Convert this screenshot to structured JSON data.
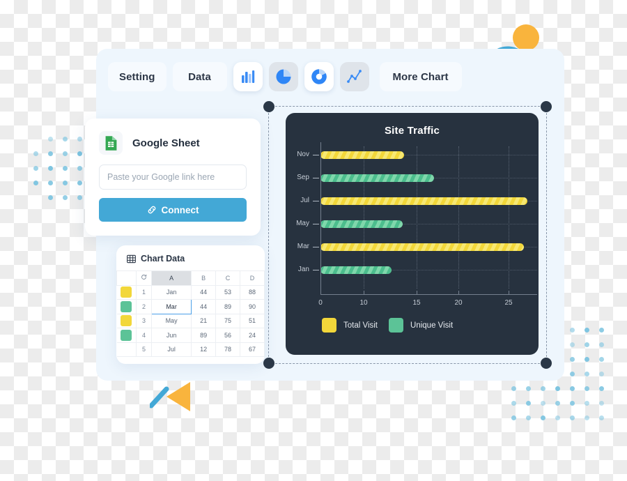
{
  "toolbar": {
    "setting_label": "Setting",
    "data_label": "Data",
    "more_chart_label": "More Chart",
    "chart_types": [
      {
        "name": "bar-chart-icon",
        "selected": true
      },
      {
        "name": "pie-chart-icon",
        "selected": false
      },
      {
        "name": "donut-chart-icon",
        "selected": true
      },
      {
        "name": "line-chart-icon",
        "selected": false
      }
    ]
  },
  "google_sheet": {
    "title": "Google Sheet",
    "icon": "google-sheets-icon",
    "input_placeholder": "Paste your Google link here",
    "input_value": "",
    "connect_label": "Connect",
    "connect_icon": "link-icon",
    "connect_color": "#43a8d6"
  },
  "chart_data_panel": {
    "title": "Chart Data",
    "icon": "table-icon",
    "refresh_icon": "refresh-icon",
    "columns": [
      "A",
      "B",
      "C",
      "D"
    ],
    "selected_column": "A",
    "selected_cell": {
      "row": 2,
      "column": "A",
      "value": "Mar"
    },
    "rows": [
      {
        "num": "1",
        "swatch": "#f2d73a",
        "A": "Jan",
        "B": "44",
        "C": "53",
        "D": "88"
      },
      {
        "num": "2",
        "swatch": "#5cc397",
        "A": "Mar",
        "B": "44",
        "C": "89",
        "D": "90"
      },
      {
        "num": "3",
        "swatch": "#f2d73a",
        "A": "May",
        "B": "21",
        "C": "75",
        "D": "51"
      },
      {
        "num": "4",
        "swatch": "#5cc397",
        "A": "Jun",
        "B": "89",
        "C": "56",
        "D": "24"
      },
      {
        "num": "5",
        "swatch": "",
        "A": "Jul",
        "B": "12",
        "C": "78",
        "D": "67"
      }
    ]
  },
  "chart_data": {
    "type": "bar",
    "orientation": "horizontal",
    "title": "Site Traffic",
    "xlabel": "",
    "ylabel": "",
    "categories": [
      "Nov",
      "Sep",
      "Jul",
      "May",
      "Mar",
      "Jan"
    ],
    "xticks": [
      "0",
      "10",
      "15",
      "20",
      "25"
    ],
    "xlim": [
      0,
      28
    ],
    "grid": true,
    "legend_position": "bottom-left",
    "background": "#27323f",
    "series": [
      {
        "name": "Total Visit",
        "color": "#f2d73a",
        "points": [
          {
            "category": "Nov",
            "value": 11.0
          },
          {
            "category": "Jul",
            "value": 27.3
          },
          {
            "category": "Mar",
            "value": 26.8
          }
        ]
      },
      {
        "name": "Unique Visit",
        "color": "#5cc397",
        "points": [
          {
            "category": "Sep",
            "value": 15.0
          },
          {
            "category": "May",
            "value": 10.8
          },
          {
            "category": "Jan",
            "value": 9.4
          }
        ]
      }
    ],
    "bars": [
      {
        "category": "Nov",
        "value": 11.0,
        "series": "Total Visit",
        "color": "#f2d73a"
      },
      {
        "category": "Sep",
        "value": 15.0,
        "series": "Unique Visit",
        "color": "#5cc397"
      },
      {
        "category": "Jul",
        "value": 27.3,
        "series": "Total Visit",
        "color": "#f2d73a"
      },
      {
        "category": "May",
        "value": 10.8,
        "series": "Unique Visit",
        "color": "#5cc397"
      },
      {
        "category": "Mar",
        "value": 26.8,
        "series": "Total Visit",
        "color": "#f2d73a"
      },
      {
        "category": "Jan",
        "value": 9.4,
        "series": "Unique Visit",
        "color": "#5cc397"
      }
    ],
    "legend": [
      {
        "label": "Total Visit",
        "color": "#f2d73a"
      },
      {
        "label": "Unique Visit",
        "color": "#5cc397"
      }
    ]
  },
  "decor": {
    "accent_blue": "#43a8d6",
    "accent_orange": "#f9b43d",
    "dot_color": "#7cc4e0"
  }
}
